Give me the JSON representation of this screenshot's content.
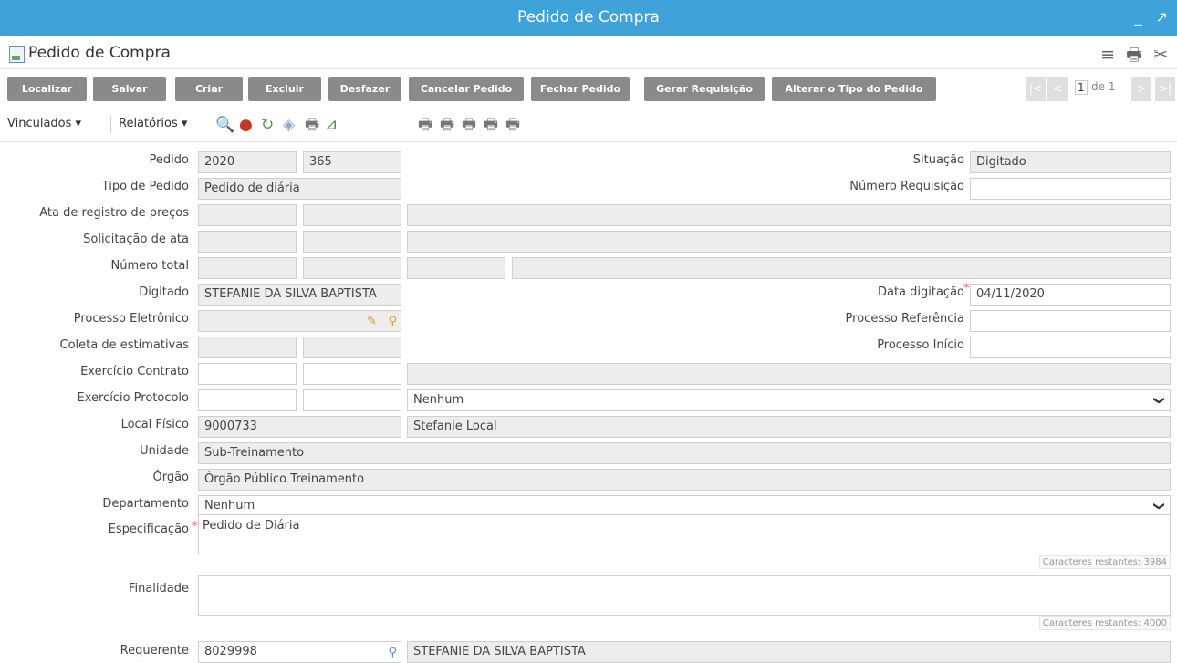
{
  "window": {
    "title": "Pedido de Compra",
    "minimize": "_",
    "maximize": "↗"
  },
  "header": {
    "title": "Pedido de Compra",
    "menu_icon": "hamburger-icon",
    "print_icon": "print-icon",
    "tools_icon": "tools-icon"
  },
  "buttons": {
    "localizar": "Localizar",
    "salvar": "Salvar",
    "criar": "Criar",
    "excluir": "Excluir",
    "desfazer": "Desfazer",
    "cancelar": "Cancelar Pedido",
    "fechar": "Fechar Pedido",
    "gerar": "Gerar Requisição",
    "alterar": "Alterar o Tipo do Pedido"
  },
  "pager": {
    "current": "1",
    "of_label": "de 1"
  },
  "toolbar": {
    "vinculados": "Vinculados ▾",
    "relatorios": "Relatórios ▾"
  },
  "form": {
    "pedido": {
      "label": "Pedido",
      "ano": "2020",
      "numero": "365"
    },
    "situacao": {
      "label": "Situação",
      "value": "Digitado"
    },
    "tipo": {
      "label": "Tipo de Pedido",
      "value": "Pedido de diária"
    },
    "num_req": {
      "label": "Número Requisição",
      "value": ""
    },
    "ata": {
      "label": "Ata de registro de preços"
    },
    "solicitacao": {
      "label": "Solicitação de ata"
    },
    "numero_total": {
      "label": "Número total"
    },
    "digitado": {
      "label": "Digitado",
      "value": "STEFANIE DA SILVA BAPTISTA"
    },
    "data_digitacao": {
      "label": "Data digitação",
      "value": "04/11/2020"
    },
    "processo_eletronico": {
      "label": "Processo Eletrônico"
    },
    "processo_referencia": {
      "label": "Processo Referência",
      "value": ""
    },
    "coleta": {
      "label": "Coleta de estimativas"
    },
    "processo_inicio": {
      "label": "Processo Início",
      "value": ""
    },
    "exercicio_contrato": {
      "label": "Exercício Contrato"
    },
    "exercicio_protocolo": {
      "label": "Exercício Protocolo",
      "select": "Nenhum"
    },
    "local_fisico": {
      "label": "Local Físico",
      "code": "9000733",
      "name": "Stefanie Local"
    },
    "unidade": {
      "label": "Unidade",
      "value": "Sub-Treinamento"
    },
    "orgao": {
      "label": "Órgão",
      "value": "Órgão Público Treinamento"
    },
    "departamento": {
      "label": "Departamento",
      "select": "Nenhum"
    },
    "especificacao": {
      "label": "Especificação",
      "value": "Pedido de Diária",
      "remaining": "Caracteres restantes: 3984"
    },
    "finalidade": {
      "label": "Finalidade",
      "value": "",
      "remaining": "Caracteres restantes: 4000"
    },
    "requerente": {
      "label": "Requerente",
      "code": "8029998",
      "name": "STEFANIE DA SILVA BAPTISTA"
    }
  },
  "required_mark": "*"
}
